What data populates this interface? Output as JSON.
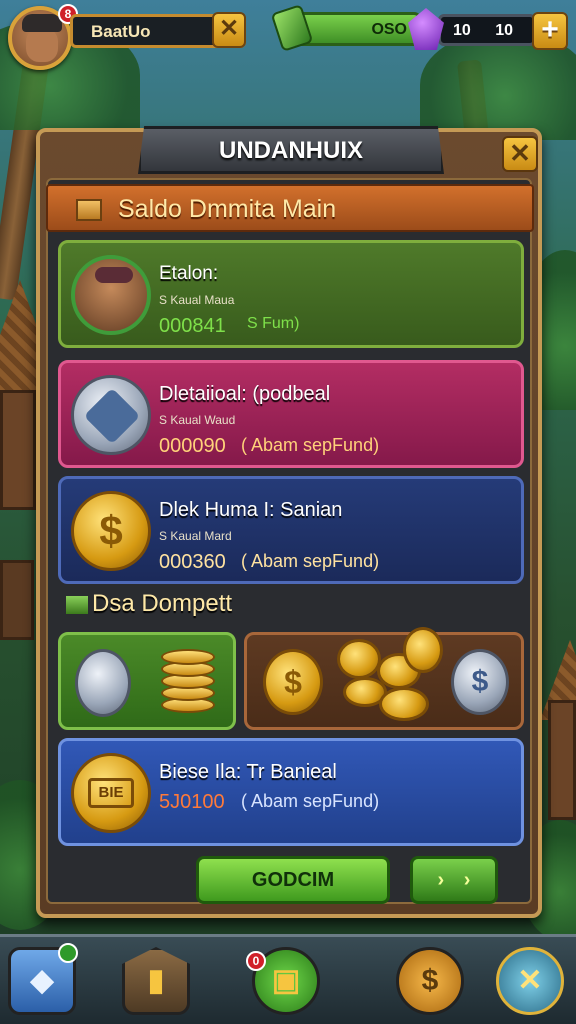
{
  "top_bar": {
    "player_name": "BaatUo",
    "avatar_badge": "8",
    "cash_value": "OSO",
    "gem_value": "10 10"
  },
  "panel": {
    "title": "UNDANHUIX",
    "section_title": "Saldo Dmmita Main",
    "cards": [
      {
        "title": "Etalon:",
        "subtitle": "S Kaual Maua",
        "amount": "000841",
        "note": "S Fum)"
      },
      {
        "title": "Dletaiioal: (podbeal",
        "subtitle": "S Kaual Waud",
        "amount": "000090",
        "note": "( Abam sepFund)"
      },
      {
        "title": "Dlek Huma I: Sanian",
        "subtitle": "S Kaual Mard",
        "amount": "000360",
        "note": "( Abam sepFund)"
      }
    ],
    "wallet_section_title": "Dsa Dompett",
    "wallet_card": {
      "title": "Biese Ila: Tr Banieal",
      "amount": "5J0100",
      "note": "( Abam sepFund)",
      "icon_text": "BIE"
    },
    "action_label": "GODCIM",
    "arrow_label": "› ›"
  },
  "nav": {
    "badge": "0"
  },
  "colors": {
    "accent_gold": "#c59a55",
    "green_amount": "#7fe04a",
    "pink_amount": "#ffd27a",
    "blue_amount": "#ffe2a0",
    "red_amount": "#ff7a3a"
  }
}
